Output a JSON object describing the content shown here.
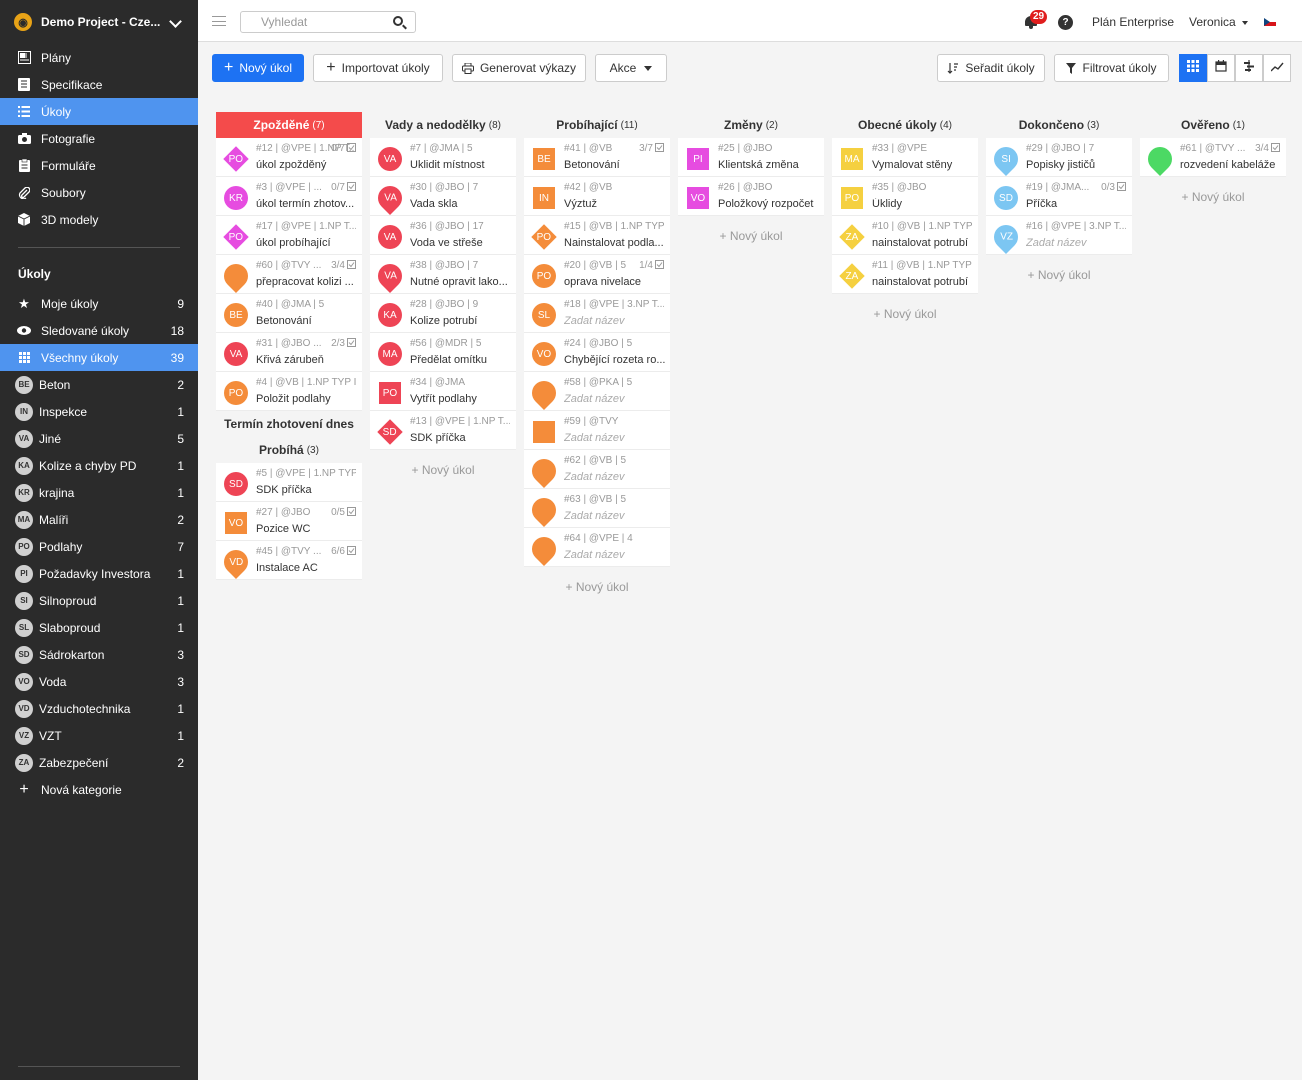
{
  "project": {
    "name": "Demo Project - Cze..."
  },
  "main_nav": [
    {
      "label": "Plány",
      "icon": "plans-icon"
    },
    {
      "label": "Specifikace",
      "icon": "specification-icon"
    },
    {
      "label": "Úkoly",
      "icon": "list-icon",
      "active": true
    },
    {
      "label": "Fotografie",
      "icon": "camera-icon"
    },
    {
      "label": "Formuláře",
      "icon": "form-icon"
    },
    {
      "label": "Soubory",
      "icon": "paperclip-icon"
    },
    {
      "label": "3D modely",
      "icon": "cube-icon"
    }
  ],
  "tasks_section": {
    "title": "Úkoly",
    "filters": [
      {
        "label": "Moje úkoly",
        "count": "9",
        "icon": "star-icon"
      },
      {
        "label": "Sledované úkoly",
        "count": "18",
        "icon": "eye-icon"
      },
      {
        "label": "Všechny úkoly",
        "count": "39",
        "icon": "grid-icon",
        "active": true
      }
    ],
    "categories": [
      {
        "code": "BE",
        "label": "Beton",
        "count": "2"
      },
      {
        "code": "IN",
        "label": "Inspekce",
        "count": "1"
      },
      {
        "code": "VA",
        "label": "Jiné",
        "count": "5"
      },
      {
        "code": "KA",
        "label": "Kolize a chyby PD",
        "count": "1"
      },
      {
        "code": "KR",
        "label": "krajina",
        "count": "1"
      },
      {
        "code": "MA",
        "label": "Malíři",
        "count": "2"
      },
      {
        "code": "PO",
        "label": "Podlahy",
        "count": "7"
      },
      {
        "code": "PI",
        "label": "Požadavky Investora",
        "count": "1"
      },
      {
        "code": "SI",
        "label": "Silnoproud",
        "count": "1"
      },
      {
        "code": "SL",
        "label": "Slaboproud",
        "count": "1"
      },
      {
        "code": "SD",
        "label": "Sádrokarton",
        "count": "3"
      },
      {
        "code": "VO",
        "label": "Voda",
        "count": "3"
      },
      {
        "code": "VD",
        "label": "Vzduchotechnika",
        "count": "1"
      },
      {
        "code": "VZ",
        "label": "VZT",
        "count": "1"
      },
      {
        "code": "ZA",
        "label": "Zabezpečení",
        "count": "2"
      }
    ],
    "new_category": "Nová kategorie"
  },
  "topbar": {
    "search_placeholder": "Vyhledat",
    "notifications": "29",
    "help": "?",
    "plan": "Plán Enterprise",
    "user": "Veronica"
  },
  "toolbar": {
    "new_task": "Nový úkol",
    "import": "Importovat úkoly",
    "generate": "Generovat výkazy",
    "actions": "Akce",
    "sort": "Seřadit úkoly",
    "filter": "Filtrovat úkoly"
  },
  "columns": [
    {
      "title": "Zpožděné",
      "count": "(7)",
      "highlight": true,
      "cards": [
        {
          "meta": "#12 | @VPE | 1.NP T...",
          "sub": "0/7",
          "title": "úkol zpožděný",
          "shape": "diamond",
          "color": "#e64ce0",
          "label": "PO"
        },
        {
          "meta": "#3 | @VPE | ...",
          "sub": "0/7",
          "title": "úkol termín zhotov...",
          "shape": "circle",
          "color": "#e64ce0",
          "label": "KR"
        },
        {
          "meta": "#17 | @VPE | 1.NP T...",
          "title": "úkol probíhající",
          "shape": "diamond",
          "color": "#e64ce0",
          "label": "PO"
        },
        {
          "meta": "#60 | @TVY ...",
          "sub": "3/4",
          "title": "přepracovat kolizi ...",
          "shape": "pin",
          "color": "#f48c3a",
          "label": ""
        },
        {
          "meta": "#40 | @JMA | 5",
          "title": "Betonování",
          "shape": "circle",
          "color": "#f48c3a",
          "label": "BE"
        },
        {
          "meta": "#31 | @JBO ...",
          "sub": "2/3",
          "title": "Křivá zárubeň",
          "shape": "circle",
          "color": "#ee4455",
          "label": "VA"
        },
        {
          "meta": "#4 | @VB | 1.NP TYP I",
          "title": "Položit podlahy",
          "shape": "circle",
          "color": "#f48c3a",
          "label": "PO"
        }
      ],
      "sections": [
        {
          "title": "Termín zhotovení dnes"
        },
        {
          "title": "Probíhá",
          "count": "(3)",
          "cards": [
            {
              "meta": "#5 | @VPE | 1.NP TYP I",
              "title": "SDK příčka",
              "shape": "circle",
              "color": "#ee4455",
              "label": "SD"
            },
            {
              "meta": "#27 | @JBO",
              "sub": "0/5",
              "title": "Pozice WC",
              "shape": "square",
              "color": "#f48c3a",
              "label": "VO"
            },
            {
              "meta": "#45 | @TVY ...",
              "sub": "6/6",
              "title": "Instalace AC",
              "shape": "pin",
              "color": "#f48c3a",
              "label": "VD"
            }
          ]
        }
      ]
    },
    {
      "title": "Vady a nedodělky",
      "count": "(8)",
      "new_task": "+ Nový úkol",
      "cards": [
        {
          "meta": "#7 | @JMA | 5",
          "title": "Uklidit místnost",
          "shape": "circle",
          "color": "#ee4455",
          "label": "VA"
        },
        {
          "meta": "#30 | @JBO | 7",
          "title": "Vada skla",
          "shape": "pin",
          "color": "#ee4455",
          "label": "VA"
        },
        {
          "meta": "#36 | @JBO | 17",
          "title": "Voda ve střeše",
          "shape": "circle",
          "color": "#ee4455",
          "label": "VA"
        },
        {
          "meta": "#38 | @JBO | 7",
          "title": "Nutné opravit lako...",
          "shape": "pin",
          "color": "#ee4455",
          "label": "VA"
        },
        {
          "meta": "#28 | @JBO | 9",
          "title": "Kolize potrubí",
          "shape": "circle",
          "color": "#ee4455",
          "label": "KA"
        },
        {
          "meta": "#56 | @MDR | 5",
          "title": "Předělat omítku",
          "shape": "circle",
          "color": "#ee4455",
          "label": "MA"
        },
        {
          "meta": "#34 | @JMA",
          "title": "Vytřít podlahy",
          "shape": "square",
          "color": "#ee4455",
          "label": "PO"
        },
        {
          "meta": "#13 | @VPE | 1.NP T...",
          "title": "SDK příčka",
          "shape": "diamond",
          "color": "#ee4455",
          "label": "SD"
        }
      ]
    },
    {
      "title": "Probíhající",
      "count": "(11)",
      "new_task": "+ Nový úkol",
      "cards": [
        {
          "meta": "#41 | @VB",
          "sub": "3/7",
          "title": "Betonování",
          "shape": "square",
          "color": "#f48c3a",
          "label": "BE"
        },
        {
          "meta": "#42 | @VB",
          "title": "Výztuž",
          "shape": "square",
          "color": "#f48c3a",
          "label": "IN"
        },
        {
          "meta": "#15 | @VB | 1.NP TYP I",
          "title": "Nainstalovat podla...",
          "shape": "diamond",
          "color": "#f48c3a",
          "label": "PO"
        },
        {
          "meta": "#20 | @VB | 5",
          "sub": "1/4",
          "title": "oprava nivelace",
          "shape": "circle",
          "color": "#f48c3a",
          "label": "PO"
        },
        {
          "meta": "#18 | @VPE | 3.NP T...",
          "title": "Zadat název",
          "placeholder": true,
          "shape": "circle",
          "color": "#f48c3a",
          "label": "SL"
        },
        {
          "meta": "#24 | @JBO | 5",
          "title": "Chybějící rozeta ro...",
          "shape": "circle",
          "color": "#f48c3a",
          "label": "VO"
        },
        {
          "meta": "#58 | @PKA | 5",
          "title": "Zadat název",
          "placeholder": true,
          "shape": "pin",
          "color": "#f48c3a",
          "label": ""
        },
        {
          "meta": "#59 | @TVY",
          "title": "Zadat název",
          "placeholder": true,
          "shape": "square",
          "color": "#f48c3a",
          "label": ""
        },
        {
          "meta": "#62 | @VB | 5",
          "title": "Zadat název",
          "placeholder": true,
          "shape": "pin",
          "color": "#f48c3a",
          "label": ""
        },
        {
          "meta": "#63 | @VB | 5",
          "title": "Zadat název",
          "placeholder": true,
          "shape": "pin",
          "color": "#f48c3a",
          "label": ""
        },
        {
          "meta": "#64 | @VPE | 4",
          "title": "Zadat název",
          "placeholder": true,
          "shape": "pin",
          "color": "#f48c3a",
          "label": ""
        }
      ]
    },
    {
      "title": "Změny",
      "count": "(2)",
      "new_task": "+ Nový úkol",
      "cards": [
        {
          "meta": "#25 | @JBO",
          "title": "Klientská změna",
          "shape": "square",
          "color": "#e64ce0",
          "label": "PI"
        },
        {
          "meta": "#26 | @JBO",
          "title": "Položkový rozpočet",
          "shape": "square",
          "color": "#e64ce0",
          "label": "VO"
        }
      ]
    },
    {
      "title": "Obecné úkoly",
      "count": "(4)",
      "new_task": "+ Nový úkol",
      "cards": [
        {
          "meta": "#33 | @VPE",
          "title": "Vymalovat stěny",
          "shape": "square",
          "color": "#f5d040",
          "label": "MA"
        },
        {
          "meta": "#35 | @JBO",
          "title": "Úklidy",
          "shape": "square",
          "color": "#f5d040",
          "label": "PO"
        },
        {
          "meta": "#10 | @VB | 1.NP TYP I",
          "title": "nainstalovat potrubí",
          "shape": "diamond",
          "color": "#f5d040",
          "label": "ZA"
        },
        {
          "meta": "#11 | @VB | 1.NP TYP I",
          "title": "nainstalovat potrubí",
          "shape": "diamond",
          "color": "#f5d040",
          "label": "ZA"
        }
      ]
    },
    {
      "title": "Dokončeno",
      "count": "(3)",
      "new_task": "+ Nový úkol",
      "cards": [
        {
          "meta": "#29 | @JBO | 7",
          "title": "Popisky jističů",
          "shape": "pin",
          "color": "#7cc6f2",
          "label": "SI"
        },
        {
          "meta": "#19 | @JMA...",
          "sub": "0/3",
          "title": "Příčka",
          "shape": "circle",
          "color": "#7cc6f2",
          "label": "SD"
        },
        {
          "meta": "#16 | @VPE | 3.NP T...",
          "title": "Zadat název",
          "placeholder": true,
          "shape": "pin",
          "color": "#7cc6f2",
          "label": "VZ"
        }
      ]
    },
    {
      "title": "Ověřeno",
      "count": "(1)",
      "new_task": "+ Nový úkol",
      "cards": [
        {
          "meta": "#61 | @TVY ...",
          "sub": "3/4",
          "title": "rozvedení kabeláže",
          "shape": "pin",
          "color": "#4cd964",
          "label": ""
        }
      ]
    }
  ]
}
